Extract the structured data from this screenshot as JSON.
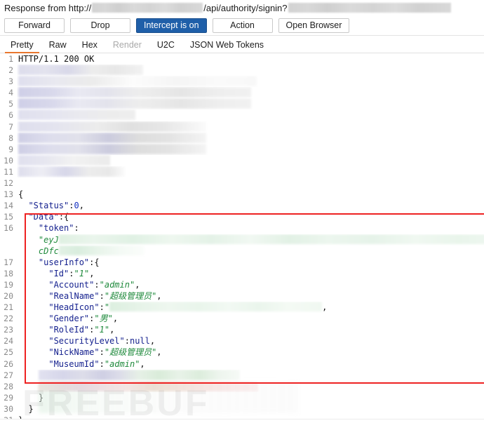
{
  "header": {
    "label_prefix": "Response from http://",
    "label_path": "/api/authority/signin?",
    "redacted_host": "",
    "redacted_query": ""
  },
  "toolbar": {
    "buttons": [
      {
        "label": "Forward",
        "primary": false
      },
      {
        "label": "Drop",
        "primary": false
      },
      {
        "label": "Intercept is on",
        "primary": true
      },
      {
        "label": "Action",
        "primary": false
      },
      {
        "label": "Open Browser",
        "primary": false
      }
    ]
  },
  "tabs": [
    {
      "label": "Pretty",
      "active": true,
      "disabled": false
    },
    {
      "label": "Raw",
      "active": false,
      "disabled": false
    },
    {
      "label": "Hex",
      "active": false,
      "disabled": false
    },
    {
      "label": "Render",
      "active": false,
      "disabled": true
    },
    {
      "label": "U2C",
      "active": false,
      "disabled": false
    },
    {
      "label": "JSON Web Tokens",
      "active": false,
      "disabled": false
    }
  ],
  "code": {
    "lines": [
      {
        "num": "1",
        "kind": "plain",
        "text": "HTTP/1.1 200 OK"
      },
      {
        "num": "2",
        "kind": "blur",
        "blur": "bh1"
      },
      {
        "num": "3",
        "kind": "blur",
        "blur": "bh2"
      },
      {
        "num": "4",
        "kind": "blur",
        "blur": "bh3"
      },
      {
        "num": "5",
        "kind": "blur",
        "blur": "bh3"
      },
      {
        "num": "6",
        "kind": "blur",
        "blur": "bh4"
      },
      {
        "num": "7",
        "kind": "blur",
        "blur": "bh5"
      },
      {
        "num": "8",
        "kind": "blur",
        "blur": "bh6"
      },
      {
        "num": "9",
        "kind": "blur",
        "blur": "bh6"
      },
      {
        "num": "10",
        "kind": "blur",
        "blur": "bh7"
      },
      {
        "num": "11",
        "kind": "blur",
        "blur": "bh8"
      },
      {
        "num": "12",
        "kind": "plain",
        "text": ""
      },
      {
        "num": "13",
        "kind": "plain",
        "text": "{"
      },
      {
        "num": "14",
        "kind": "kv",
        "indent": 2,
        "key": "\"Status\"",
        "sep": ":",
        "valueClass": "n",
        "value": "0",
        "tail": ","
      },
      {
        "num": "15",
        "kind": "kv",
        "indent": 2,
        "key": "\"Data\"",
        "sep": ":",
        "valueClass": "p",
        "value": "{",
        "tail": ""
      },
      {
        "num": "16",
        "kind": "kv",
        "indent": 4,
        "key": "\"token\"",
        "sep": ":",
        "valueClass": "p",
        "value": "",
        "tail": ""
      },
      {
        "num": "",
        "kind": "token1",
        "indent": 4,
        "prefix": "\"eyJ"
      },
      {
        "num": "",
        "kind": "token2",
        "indent": 4,
        "prefix": "cDfc"
      },
      {
        "num": "17",
        "kind": "kv",
        "indent": 4,
        "key": "\"userInfo\"",
        "sep": ":",
        "valueClass": "p",
        "value": "{",
        "tail": ""
      },
      {
        "num": "18",
        "kind": "kv",
        "indent": 6,
        "key": "\"Id\"",
        "sep": ":",
        "valueClass": "s",
        "value": "\"1\"",
        "tail": ","
      },
      {
        "num": "19",
        "kind": "kv",
        "indent": 6,
        "key": "\"Account\"",
        "sep": ":",
        "valueClass": "s",
        "value": "\"admin\"",
        "tail": ","
      },
      {
        "num": "20",
        "kind": "kv",
        "indent": 6,
        "key": "\"RealName\"",
        "sep": ":",
        "valueClass": "s",
        "value": "\"超级管理员\"",
        "tail": ","
      },
      {
        "num": "21",
        "kind": "headicon",
        "indent": 6,
        "key": "\"HeadIcon\"",
        "sep": ":",
        "open": "\"",
        "tail": ","
      },
      {
        "num": "22",
        "kind": "kv",
        "indent": 6,
        "key": "\"Gender\"",
        "sep": ":",
        "valueClass": "s",
        "value": "\"男\"",
        "tail": ","
      },
      {
        "num": "23",
        "kind": "kv",
        "indent": 6,
        "key": "\"RoleId\"",
        "sep": ":",
        "valueClass": "s",
        "value": "\"1\"",
        "tail": ","
      },
      {
        "num": "24",
        "kind": "kv",
        "indent": 6,
        "key": "\"SecurityLevel\"",
        "sep": ":",
        "valueClass": "nul",
        "value": "null",
        "tail": ","
      },
      {
        "num": "25",
        "kind": "kv",
        "indent": 6,
        "key": "\"NickName\"",
        "sep": ":",
        "valueClass": "s",
        "value": "\"超级管理员\"",
        "tail": ","
      },
      {
        "num": "26",
        "kind": "kv",
        "indent": 6,
        "key": "\"MuseumId\"",
        "sep": ":",
        "valueClass": "s",
        "value": "\"admin\"",
        "tail": ","
      },
      {
        "num": "27",
        "kind": "multi",
        "indent": 4,
        "blur": "mrow27"
      },
      {
        "num": "28",
        "kind": "multi",
        "indent": 4,
        "blur": "mrow28"
      },
      {
        "num": "29",
        "kind": "plain",
        "text": "    }"
      },
      {
        "num": "30",
        "kind": "plain",
        "text": "  }"
      },
      {
        "num": "31",
        "kind": "plain",
        "text": "}"
      }
    ]
  },
  "annotation": {
    "box_color": "#ee2222"
  },
  "watermark": {
    "text": "FREEBUF"
  }
}
